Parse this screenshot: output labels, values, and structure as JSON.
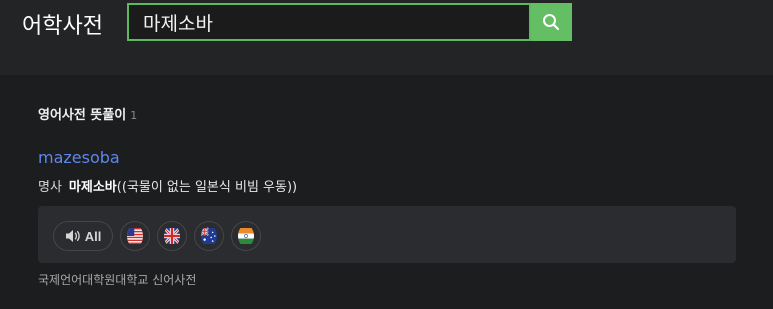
{
  "header": {
    "logo": "어학사전",
    "search": {
      "value": "마제소바",
      "button_icon": "search-icon"
    }
  },
  "colors": {
    "accent_green": "#63be64",
    "link_blue": "#5f86ea",
    "panel": "#2b2c2f"
  },
  "section": {
    "title": "영어사전 뜻풀이",
    "count": "1"
  },
  "entry": {
    "word": "mazesoba",
    "pos": "명사",
    "highlight": "마제소바",
    "definition": "((국물이 없는 일본식 비빔 우동))"
  },
  "audio": {
    "all_label": "All",
    "speaker_icon": "speaker-icon",
    "flags": [
      "us-flag-icon",
      "uk-flag-icon",
      "au-flag-icon",
      "in-flag-icon"
    ]
  },
  "source": "국제언어대학원대학교 신어사전"
}
